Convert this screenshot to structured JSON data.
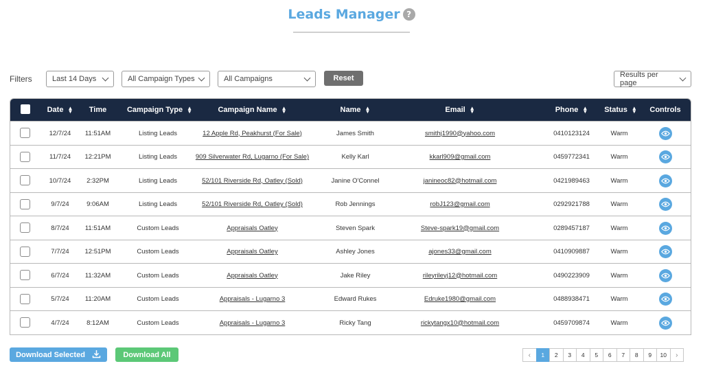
{
  "header": {
    "title": "Leads Manager",
    "help_icon": "question-circle-icon",
    "help_glyph": "?"
  },
  "filters": {
    "label": "Filters",
    "date_range": "Last 14 Days",
    "campaign_type": "All Campaign Types",
    "campaign": "All Campaigns",
    "reset_label": "Reset",
    "results_per_page": "Results per page"
  },
  "table": {
    "columns": {
      "date": "Date",
      "time": "Time",
      "campaign_type": "Campaign Type",
      "campaign_name": "Campaign Name",
      "name": "Name",
      "email": "Email",
      "phone": "Phone",
      "status": "Status",
      "controls": "Controls"
    },
    "rows": [
      {
        "date": "12/7/24",
        "time": "11:51AM",
        "type": "Listing Leads",
        "campaign": "12 Apple Rd, Peakhurst (For Sale)",
        "name": "James Smith",
        "email": "smithj1990@yahoo.com",
        "phone": "0410123124",
        "status": "Warm"
      },
      {
        "date": "11/7/24",
        "time": "12:21PM",
        "type": "Listing Leads",
        "campaign": "909 Silverwater Rd, Lugarno (For Sale)",
        "name": "Kelly Karl",
        "email": "kkarl909@gmail.com",
        "phone": "0459772341",
        "status": "Warm"
      },
      {
        "date": "10/7/24",
        "time": "2:32PM",
        "type": "Listing Leads",
        "campaign": "52/101 Riverside Rd, Oatley (Sold)",
        "name": "Janine O'Connel",
        "email": "janineoc82@hotmail.com",
        "phone": "0421989463",
        "status": "Warm"
      },
      {
        "date": "9/7/24",
        "time": "9:06AM",
        "type": "Listing Leads",
        "campaign": "52/101 Riverside Rd, Oatley (Sold)",
        "name": "Rob Jennings",
        "email": "robJ123@gmail.com",
        "phone": "0292921788",
        "status": "Warm"
      },
      {
        "date": "8/7/24",
        "time": "11:51AM",
        "type": "Custom Leads",
        "campaign": "Appraisals Oatley",
        "name": "Steven Spark",
        "email": "Steve-spark19@gmail.com",
        "phone": "0289457187",
        "status": "Warm"
      },
      {
        "date": "7/7/24",
        "time": "12:51PM",
        "type": "Custom Leads",
        "campaign": "Appraisals Oatley",
        "name": "Ashley Jones",
        "email": "ajones33@gmail.com",
        "phone": "0410909887",
        "status": "Warm"
      },
      {
        "date": "6/7/24",
        "time": "11:32AM",
        "type": "Custom Leads",
        "campaign": "Appraisals Oatley",
        "name": "Jake Riley",
        "email": "rileyrileyj12@hotmail.com",
        "phone": "0490223909",
        "status": "Warm"
      },
      {
        "date": "5/7/24",
        "time": "11:20AM",
        "type": "Custom Leads",
        "campaign": "Appraisals - Lugarno 3",
        "name": "Edward Rukes",
        "email": "Edruke1980@gmail.com",
        "phone": "0488938471",
        "status": "Warm"
      },
      {
        "date": "4/7/24",
        "time": "8:12AM",
        "type": "Custom Leads",
        "campaign": "Appraisals - Lugarno 3",
        "name": "Ricky Tang",
        "email": "rickytangx10@hotmail.com",
        "phone": "0459709874",
        "status": "Warm"
      }
    ]
  },
  "footer": {
    "download_selected_label": "Download Selected",
    "download_icon": "download-icon",
    "download_all_label": "Download All",
    "pagination": {
      "prev_glyph": "‹",
      "next_glyph": "›",
      "pages": [
        "1",
        "2",
        "3",
        "4",
        "5",
        "6",
        "7",
        "8",
        "9",
        "10"
      ],
      "current": "1"
    }
  },
  "colors": {
    "accent": "#5aa8e0",
    "header_bg": "#1a2942",
    "download_all": "#5cc877",
    "reset": "#6f6f6f"
  }
}
